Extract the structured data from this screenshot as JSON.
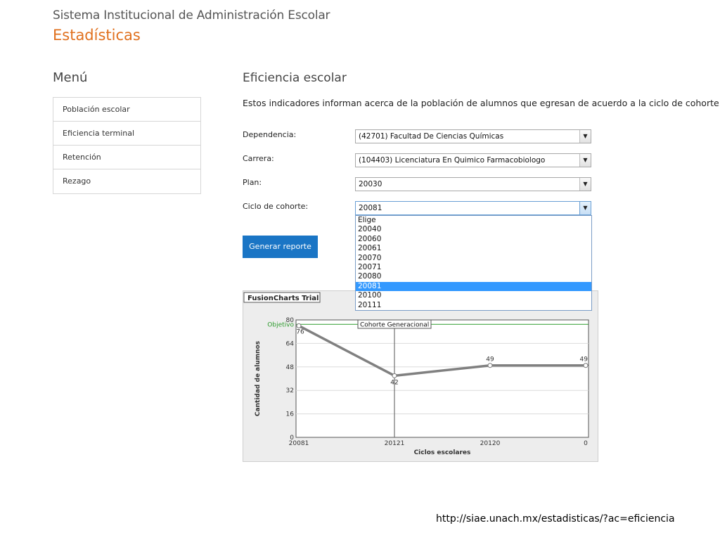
{
  "header": {
    "app_title": "Sistema Institucional de Administración Escolar",
    "section": "Estadísticas"
  },
  "menu": {
    "title": "Menú",
    "items": [
      {
        "label": "Población escolar"
      },
      {
        "label": "Eficiencia terminal"
      },
      {
        "label": "Retención"
      },
      {
        "label": "Rezago"
      }
    ]
  },
  "main": {
    "heading": "Eficiencia escolar",
    "intro": "Estos indicadores informan acerca de la población de alumnos que egresan de acuerdo a la ciclo de cohorte."
  },
  "form": {
    "dependencia": {
      "label": "Dependencia:",
      "value": "(42701) Facultad De Ciencias Químicas"
    },
    "carrera": {
      "label": "Carrera:",
      "value": "(104403) Licenciatura En Quimico Farmacobiologo"
    },
    "plan": {
      "label": "Plan:",
      "value": "20030"
    },
    "ciclo": {
      "label": "Ciclo de cohorte:",
      "value": "20081",
      "options": [
        "Elige",
        "20040",
        "20060",
        "20061",
        "20070",
        "20071",
        "20080",
        "20081",
        "20100",
        "20111"
      ],
      "selected_index": 7
    },
    "button": "Generar reporte"
  },
  "chart_data": {
    "type": "line",
    "badge": "FusionCharts Trial",
    "categories": [
      "20081",
      "20121",
      "20120",
      "0"
    ],
    "values": [
      76,
      42,
      49,
      49
    ],
    "value_labels": [
      "76",
      "42",
      "49",
      "49"
    ],
    "ylabel": "Cantidad de alumnos",
    "xlabel": "Ciclos escolares",
    "ylim": [
      0,
      80
    ],
    "yticks": [
      0,
      16,
      32,
      48,
      64,
      80
    ],
    "objective": {
      "label": "Objetivo",
      "value": 77
    },
    "annotation": {
      "label": "Cohorte Generacional",
      "category_index": 1
    },
    "colors": {
      "line": "#808080",
      "objective": "#2e9b2e",
      "plot_bg": "#ffffff"
    }
  },
  "footer": {
    "url": "http://siae.unach.mx/estadisticas/?ac=eficiencia"
  }
}
